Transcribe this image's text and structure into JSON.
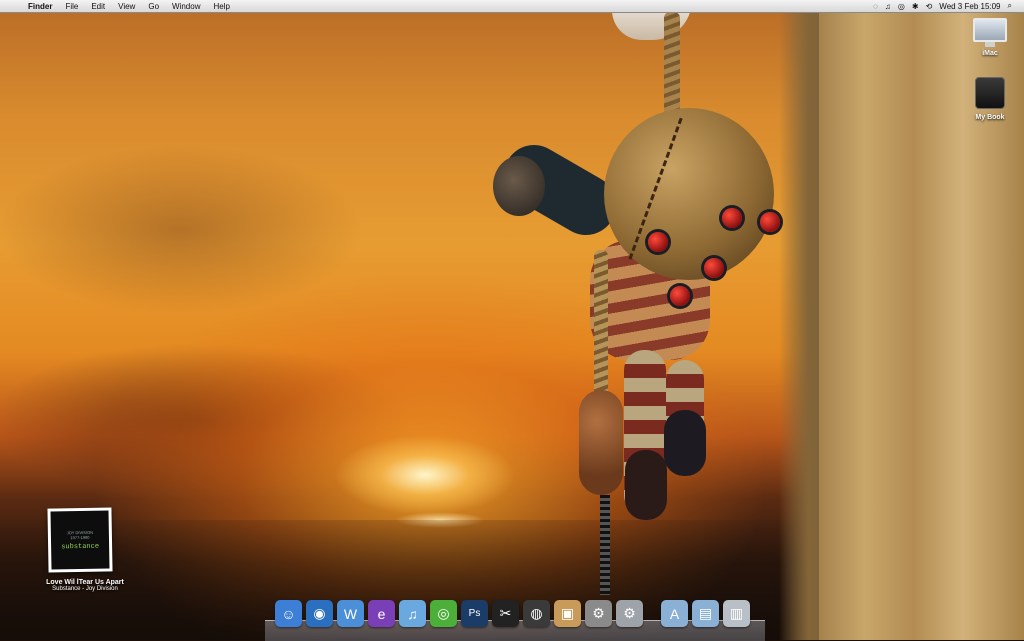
{
  "menubar": {
    "apple_glyph": "",
    "app_name": "Finder",
    "items": [
      "File",
      "Edit",
      "View",
      "Go",
      "Window",
      "Help"
    ],
    "status": {
      "sync_glyph": "◌",
      "music_glyph": "♫",
      "network_glyph": "◎",
      "bluetooth_glyph": "✱",
      "timemachine_glyph": "⟲",
      "clock": "Wed 3 Feb  15:09",
      "spotlight_glyph": "⌕"
    }
  },
  "desktop": {
    "icons": [
      {
        "label": "iMac",
        "icon": "imac-icon"
      },
      {
        "label": "My Book",
        "icon": "external-drive-icon"
      }
    ],
    "now_playing": {
      "title": "Love Wil lTear Us Apart",
      "subtitle": "Substance - Joy Division",
      "art_text": "substance",
      "art_small1": "JOY DIVISION",
      "art_small2": "1977-1980"
    }
  },
  "dock": {
    "apps": [
      {
        "name": "finder-icon",
        "glyph": "☺",
        "color": "#3d7fd6"
      },
      {
        "name": "safari-icon",
        "glyph": "◉",
        "color": "#2a6fc0"
      },
      {
        "name": "dreamweaver-icon",
        "glyph": "W",
        "color": "#4a8fd8"
      },
      {
        "name": "fireworks-icon",
        "glyph": "e",
        "color": "#7a3fb6"
      },
      {
        "name": "itunes-icon",
        "glyph": "♫",
        "color": "#6aa8e0"
      },
      {
        "name": "feed-reader-icon",
        "glyph": "◎",
        "color": "#4caf3a"
      },
      {
        "name": "photoshop-icon",
        "glyph": "Ps",
        "color": "#1b3c66"
      },
      {
        "name": "final-cut-icon",
        "glyph": "✂",
        "color": "#222222"
      },
      {
        "name": "aperture-icon",
        "glyph": "◍",
        "color": "#3a3a3a"
      },
      {
        "name": "preview-icon",
        "glyph": "▣",
        "color": "#c89b5a"
      },
      {
        "name": "automator-icon",
        "glyph": "⚙",
        "color": "#8a8a8a"
      },
      {
        "name": "system-preferences-icon",
        "glyph": "⚙",
        "color": "#9ea3aa"
      }
    ],
    "stacks": [
      {
        "name": "applications-folder-icon",
        "glyph": "A",
        "color": "#8bb0d6"
      },
      {
        "name": "documents-folder-icon",
        "glyph": "▤",
        "color": "#8bb0d6"
      },
      {
        "name": "trash-icon",
        "glyph": "▥",
        "color": "#b9bfc6"
      }
    ]
  }
}
